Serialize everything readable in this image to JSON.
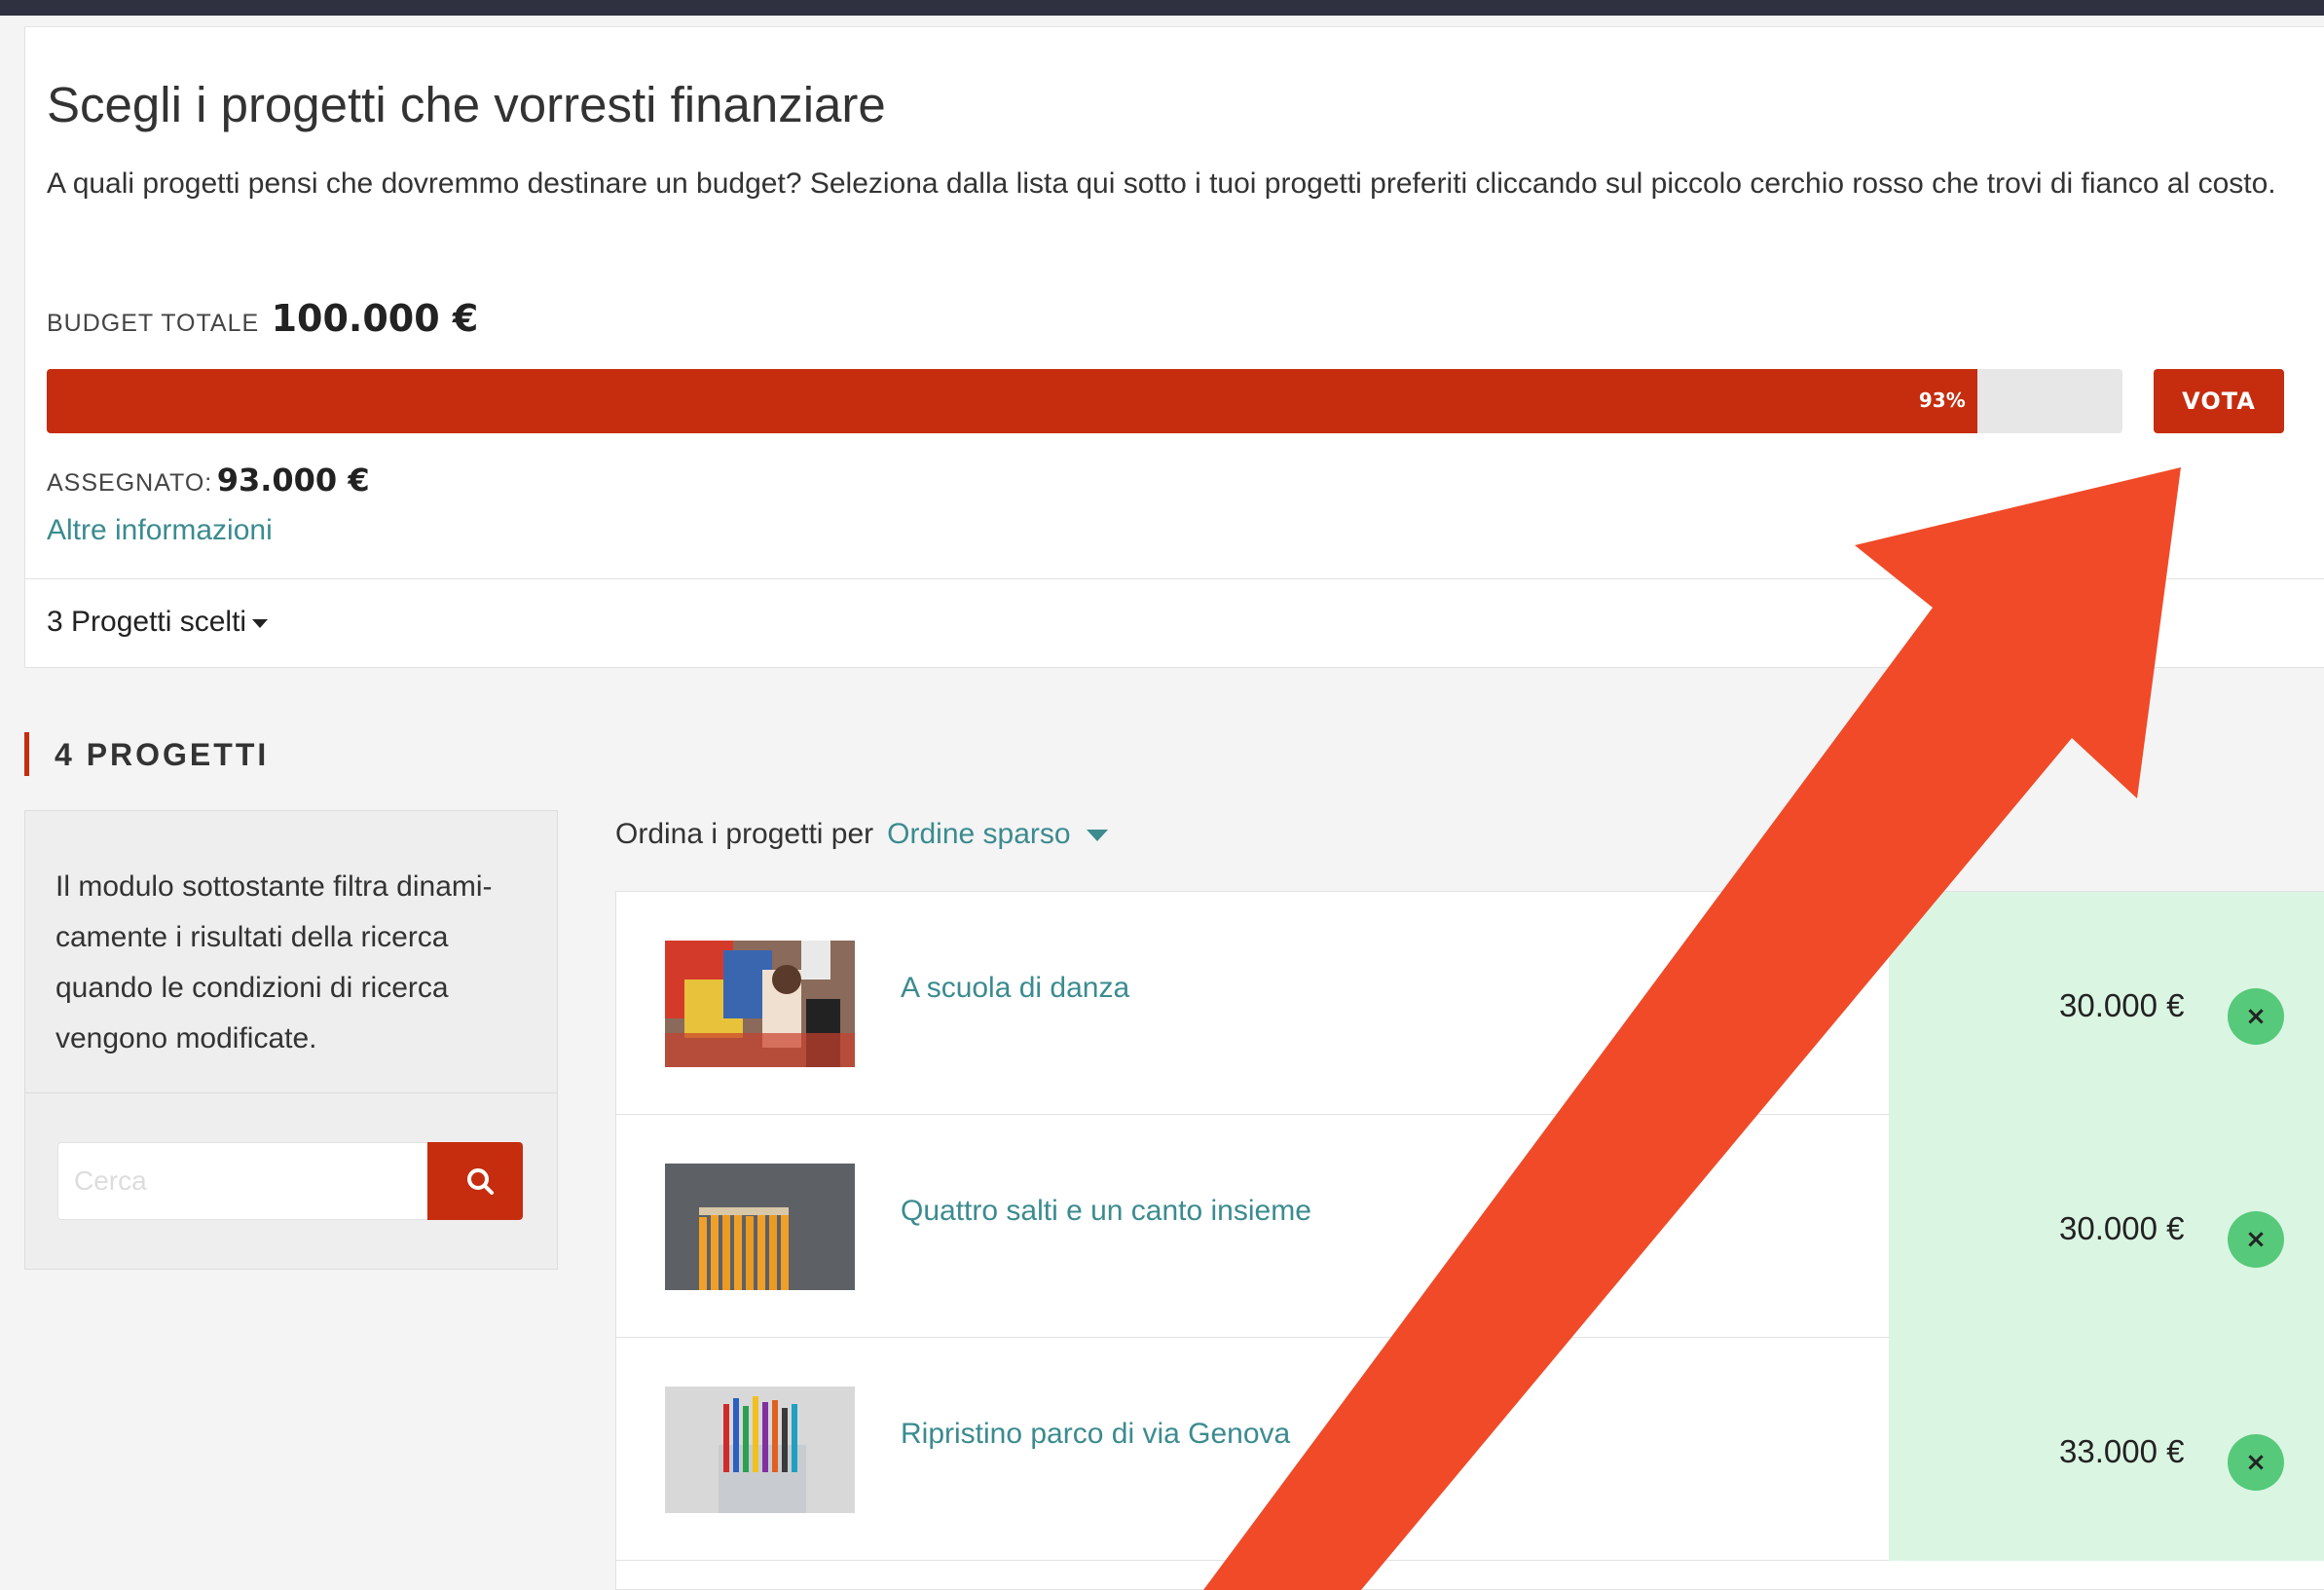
{
  "header": {
    "title": "Scegli i progetti che vorresti finanziare",
    "description": "A quali progetti pensi che dovremmo destinare un budget? Seleziona dalla lista qui sotto i tuoi progetti preferiti cliccando sul piccolo cerchio rosso che trovi di fianco al costo."
  },
  "budget": {
    "label": "BUDGET TOTALE",
    "value": "100.000 €",
    "progress_label": "93%",
    "progress_fraction": 0.93,
    "vote_label": "VOTA",
    "assigned_label": "ASSEGNATO:",
    "assigned_value": "93.000 €",
    "more_info": "Altre informazioni",
    "chosen_toggle": "3 Progetti scelti",
    "accent_color": "#c52d0e"
  },
  "section": {
    "title": "4 PROGETTI"
  },
  "filter": {
    "text": "Il modulo sottostante filtra dinami-camente i risultati della ricerca quando le condizioni di ricerca vengono modificate.",
    "search_placeholder": "Cerca"
  },
  "sort": {
    "label": "Ordina i progetti per",
    "value": "Ordine sparso"
  },
  "projects": [
    {
      "name": "A scuola di danza",
      "price": "30.000 €",
      "selected": true,
      "remove": "×"
    },
    {
      "name": "Quattro salti e un canto insieme",
      "price": "30.000 €",
      "selected": true,
      "remove": "×"
    },
    {
      "name": "Ripristino parco di via Genova",
      "price": "33.000 €",
      "selected": true,
      "remove": "×"
    }
  ],
  "annotation": {
    "arrow_color": "#f04a28"
  }
}
